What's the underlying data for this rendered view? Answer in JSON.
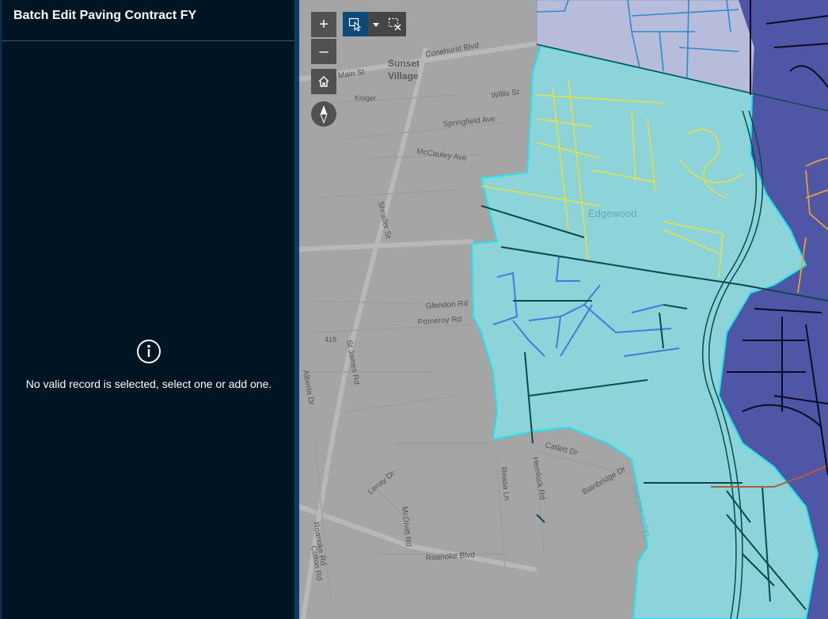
{
  "panel": {
    "title": "Batch Edit Paving Contract FY",
    "empty_message": "No valid record is selected, select one or add one."
  },
  "map_controls": {
    "zoom_in": "+",
    "zoom_out": "–"
  },
  "map_labels": {
    "sunset": "Sunset",
    "village": "Village",
    "main_st": "E Main St",
    "conehurst": "Conehurst Blvd",
    "kroger": "Kroger",
    "willis": "Willis St",
    "springfield": "Springfield Ave",
    "mcauley": "McCauley Ave",
    "edgewood": "Edgewood",
    "shrader": "Shrader St",
    "glendon": "Glendon Rd",
    "pomeroy": "Pomeroy Rd",
    "route419": "419",
    "st_james": "St James Rd",
    "catlett": "Catlett Dr",
    "bainbridge": "Bainbridge Dr",
    "salem": "SALEM (CITY)",
    "hemlock": "Hemlock Rd",
    "reasa": "Reasa Ln",
    "lenay": "Lenay Dr",
    "mcdivitt": "McDivitt Rd",
    "roanoke": "Roanoke Blvd",
    "colton": "Colton Rd",
    "alberta": "Alberta Dr",
    "roanoke_road": "Roanoke Rd"
  },
  "colors": {
    "panel_bg": "#001524",
    "teal_region": "#8cd3da",
    "teal_border": "#23e3ef",
    "purple_region": "#4f56a5",
    "lavender_region": "#b6bcd9",
    "yellow_road": "#e8e23a",
    "blue_road": "#3c7fd8",
    "dark_road": "#0c4a4a",
    "orange_road": "#e0a23a"
  }
}
